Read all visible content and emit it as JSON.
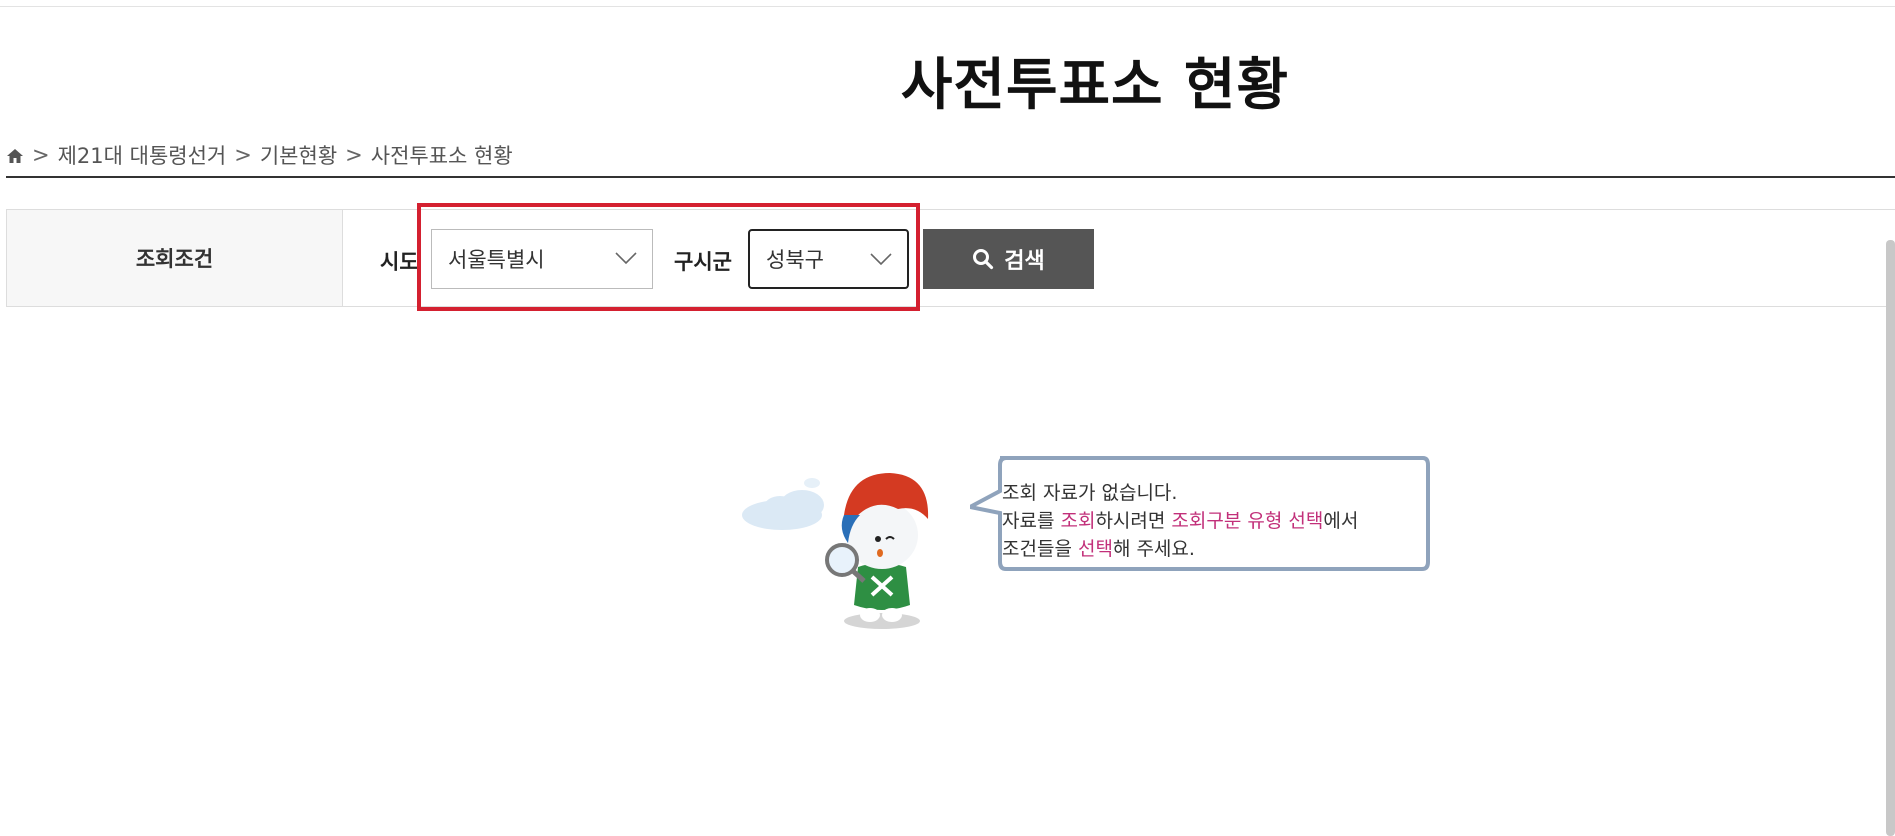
{
  "page": {
    "title": "사전투표소 현황"
  },
  "breadcrumb": {
    "sep": ">",
    "items": [
      "제21대 대통령선거",
      "기본현황",
      "사전투표소 현황"
    ]
  },
  "search": {
    "condition_label": "조회조건",
    "sido_label": "시도",
    "sido_value": "서울특별시",
    "gusi_label": "구시군",
    "gusi_value": "성북구",
    "button_label": "검색"
  },
  "empty_state": {
    "line1": "조회 자료가 없습니다.",
    "line2_a": "자료를 ",
    "line2_b": "조회",
    "line2_c": "하시려면 ",
    "line2_d": "조회구분 유형 선택",
    "line2_e": "에서",
    "line3_a": "조건들을 ",
    "line3_b": "선택",
    "line3_c": "해 주세요."
  },
  "colors": {
    "highlight_border": "#d42030",
    "button_bg": "#555555",
    "emphasis_text": "#c2307a"
  }
}
